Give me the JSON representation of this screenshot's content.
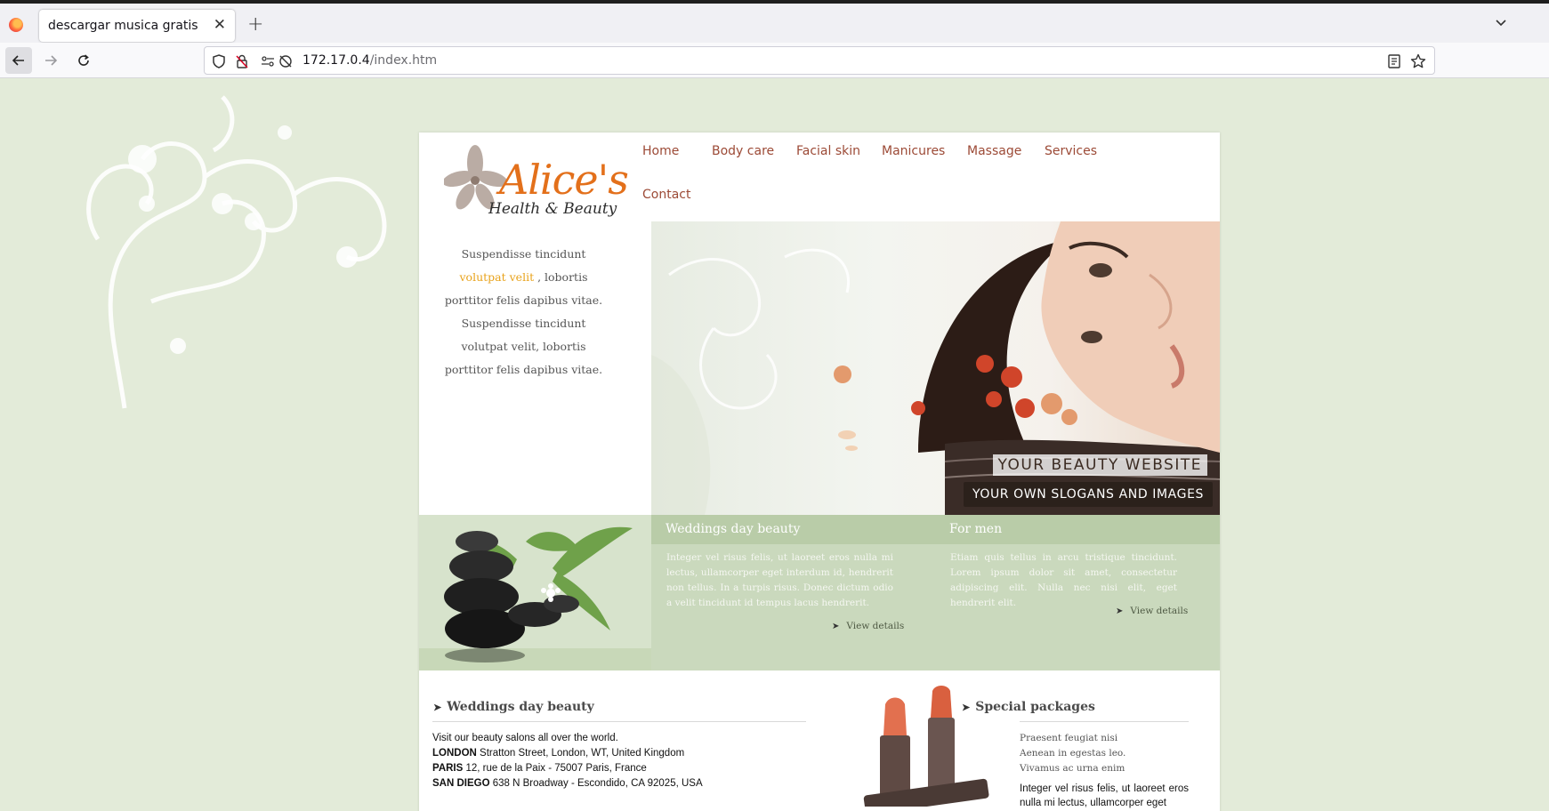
{
  "browser": {
    "tab_title": "descargar musica gratis",
    "url_host": "172.17.0.4",
    "url_path": "/index.htm"
  },
  "logo": {
    "name": "Alice's",
    "tagline": "Health & Beauty"
  },
  "menu": [
    "Home",
    "Body care",
    "Facial skin",
    "Manicures",
    "Massage",
    "Services",
    "Contact"
  ],
  "intro": {
    "part1": "Suspendisse tincidunt",
    "highlight": "volutpat velit",
    "part2": ", lobortis porttitor felis dapibus vitae. Suspendisse tincidunt volutpat velit, lobortis porttitor felis dapibus vitae."
  },
  "hero": {
    "slogan_main": "YOUR BEAUTY WEBSITE",
    "slogan_sub": "YOUR OWN SLOGANS AND IMAGES"
  },
  "features": [
    {
      "title": "Weddings day beauty",
      "text": "Integer vel risus felis, ut laoreet eros nulla mi lectus, ullamcorper eget interdum id, hendrerit non tellus. In a turpis risus. Donec dictum odio a velit tincidunt id tempus lacus hendrerit.",
      "link": "View details"
    },
    {
      "title": "For men",
      "text": "Etiam quis tellus in arcu tristique tincidunt. Lorem ipsum dolor sit amet, consectetur adipiscing elit. Nulla nec nisi elit, eget hendrerit elit.",
      "link": "View details"
    }
  ],
  "weddings": {
    "heading": "Weddings day beauty",
    "intro": "Visit our beauty salons all over the world.",
    "locations": [
      {
        "city": "LONDON",
        "address": "Stratton Street, London, WT, United Kingdom"
      },
      {
        "city": "PARIS",
        "address": "12, rue de la Paix - 75007 Paris, France"
      },
      {
        "city": "SAN DIEGO",
        "address": "638 N Broadway - Escondido, CA 92025, USA"
      }
    ]
  },
  "packages": {
    "heading": "Special packages",
    "list": [
      "Praesent feugiat nisi",
      "Aenean in egestas leo.",
      "Vivamus ac urna enim"
    ],
    "text": "Integer vel risus felis, ut laoreet eros nulla mi lectus, ullamcorper eget"
  },
  "colors": {
    "page_bg": "#e3ebd9",
    "menu_link": "#9c4a36",
    "logo_orange": "#e3701b",
    "highlight": "#e8a21a",
    "band_bg": "#cad9bd"
  }
}
